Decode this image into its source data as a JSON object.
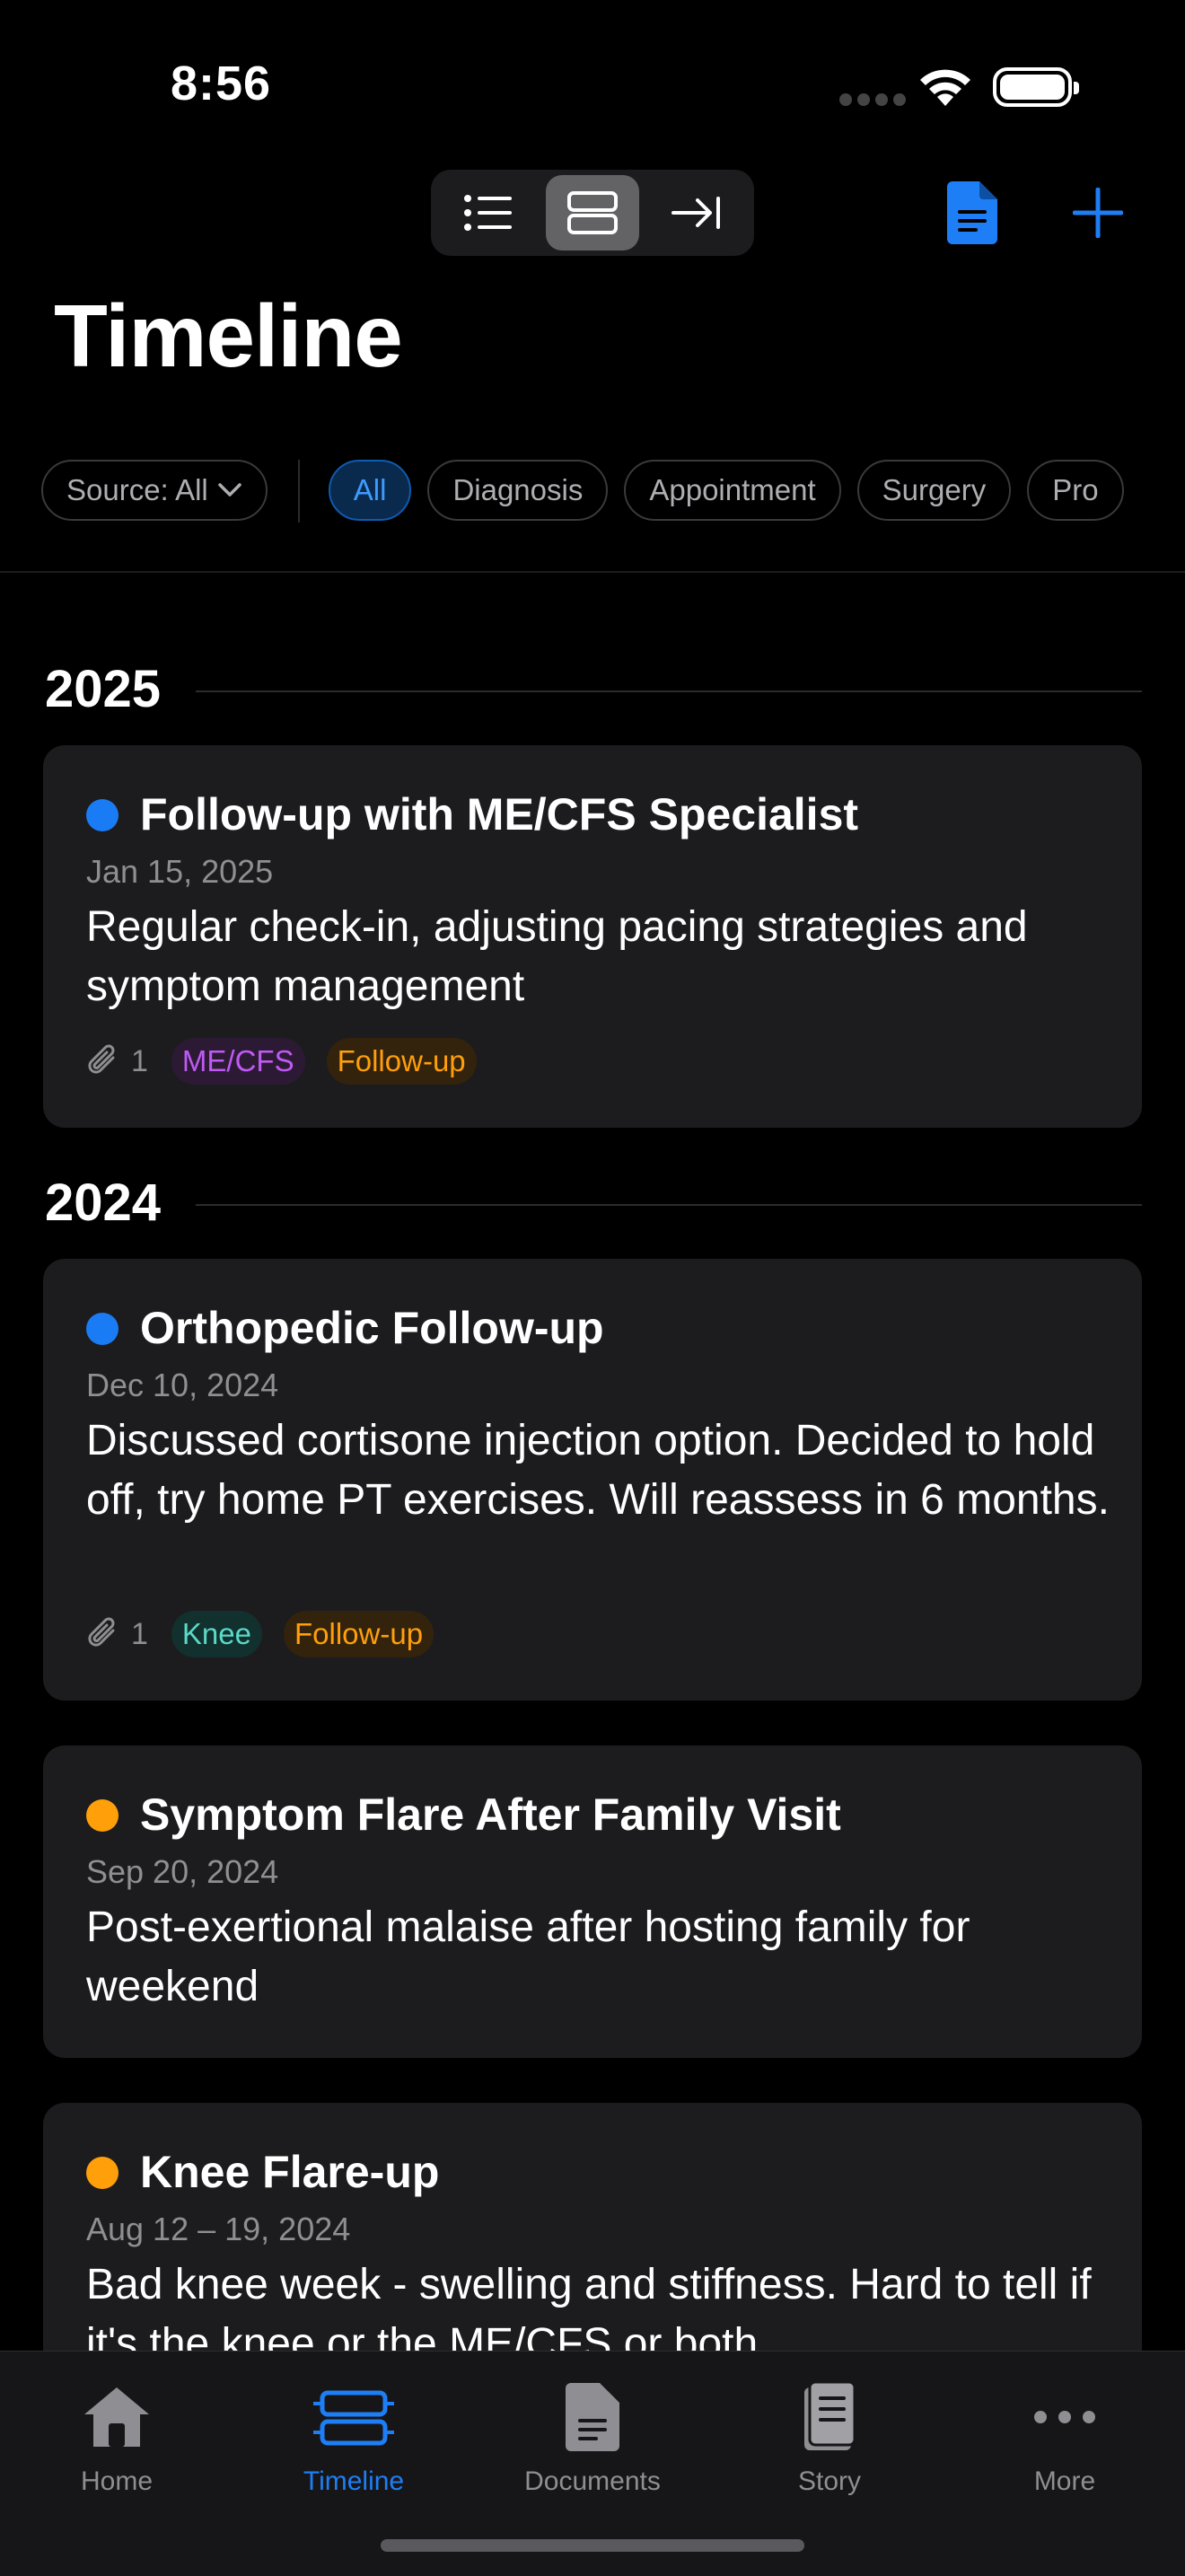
{
  "status_bar": {
    "time": "8:56"
  },
  "toolbar": {
    "view_options": [
      "list-icon",
      "cards-icon",
      "jump-icon"
    ],
    "selected_view": "cards-icon"
  },
  "page": {
    "title": "Timeline"
  },
  "filters": {
    "source_label": "Source: All",
    "categories": [
      "All",
      "Diagnosis",
      "Appointment",
      "Surgery",
      "Pro"
    ],
    "selected": "All"
  },
  "sections": [
    {
      "year": "2025",
      "events": [
        {
          "title": "Follow-up with ME/CFS Specialist",
          "date": "Jan 15, 2025",
          "description": "Regular check-in, adjusting pacing strategies and symptom management",
          "dot_color": "#1a7cf5",
          "attachments": "1",
          "tags": [
            {
              "label": "ME/CFS",
              "color": "#bf5af2",
              "bg": "#2c1a35"
            },
            {
              "label": "Follow-up",
              "color": "#ff9f0a",
              "bg": "#33230c"
            }
          ]
        }
      ]
    },
    {
      "year": "2024",
      "events": [
        {
          "title": "Orthopedic Follow-up",
          "date": "Dec 10, 2024",
          "description": "Discussed cortisone injection option. Decided to hold off, try home PT exercises. Will reassess in 6 months.",
          "dot_color": "#1a7cf5",
          "attachments": "1",
          "tags": [
            {
              "label": "Knee",
              "color": "#5ad8c8",
              "bg": "#12302d"
            },
            {
              "label": "Follow-up",
              "color": "#ff9f0a",
              "bg": "#33230c"
            }
          ]
        },
        {
          "title": "Symptom Flare After Family Visit",
          "date": "Sep 20, 2024",
          "description": "Post-exertional malaise after hosting family for weekend",
          "dot_color": "#ff9f0a"
        },
        {
          "title": "Knee Flare-up",
          "date": "Aug 12 – 19, 2024",
          "description": "Bad knee week - swelling and stiffness. Hard to tell if it's the knee or the ME/CFS or both.",
          "dot_color": "#ff9f0a"
        }
      ]
    }
  ],
  "tab_bar": {
    "tabs": [
      {
        "label": "Home",
        "icon": "house-icon"
      },
      {
        "label": "Timeline",
        "icon": "timeline-icon"
      },
      {
        "label": "Documents",
        "icon": "document-icon"
      },
      {
        "label": "Story",
        "icon": "book-icon"
      },
      {
        "label": "More",
        "icon": "ellipsis-icon"
      }
    ],
    "selected": "Timeline"
  },
  "colors": {
    "accent": "#1e7ef5",
    "background": "#000000",
    "card": "#1c1c1e"
  }
}
